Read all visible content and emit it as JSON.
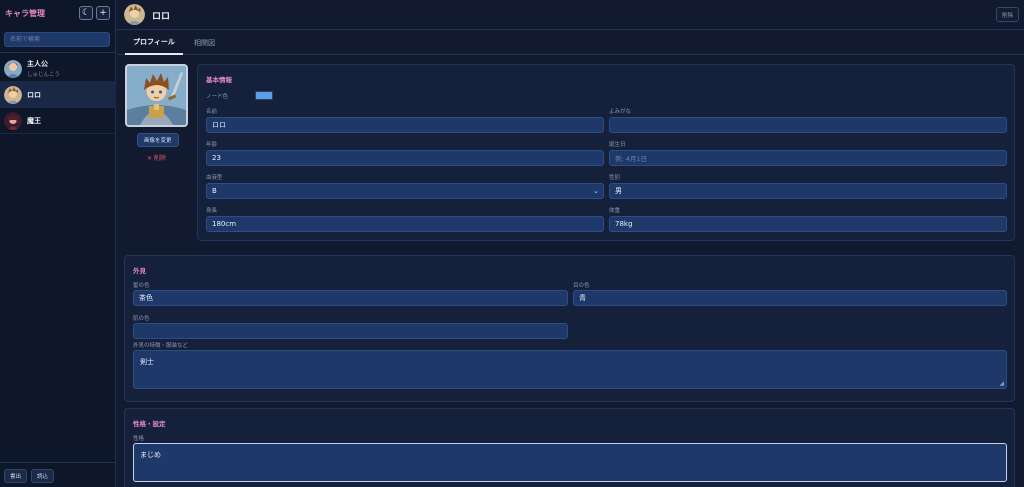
{
  "sidebar": {
    "title": "キャラ管理",
    "theme_icon": "☾",
    "add_icon": "+",
    "search_placeholder": "名前で検索",
    "characters": [
      {
        "name": "主人公",
        "reading": "しゅじんこう"
      },
      {
        "name": "ロロ",
        "reading": ""
      },
      {
        "name": "魔王",
        "reading": ""
      }
    ],
    "export_label": "書出",
    "import_label": "読込"
  },
  "header": {
    "name": "ロロ",
    "delete_label": "削除"
  },
  "tabs": [
    {
      "label": "プロフィール",
      "active": true
    },
    {
      "label": "相関図",
      "active": false
    }
  ],
  "image": {
    "change_label": "画像を変更",
    "delete_label": "✕ 削除"
  },
  "basic": {
    "title": "基本情報",
    "node_color_label": "ノード色",
    "node_color": "#5d9ee8",
    "name_label": "名前",
    "name_value": "ロロ",
    "reading_label": "よみがな",
    "reading_value": "",
    "age_label": "年齢",
    "age_value": "23",
    "birthday_label": "誕生日",
    "birthday_placeholder": "例: 4月1日",
    "blood_label": "血液型",
    "blood_value": "B",
    "gender_label": "性別",
    "gender_value": "男",
    "height_label": "身長",
    "height_value": "180cm",
    "weight_label": "体重",
    "weight_value": "78kg"
  },
  "appearance": {
    "title": "外見",
    "hair_label": "髪の色",
    "hair_value": "茶色",
    "eye_label": "目の色",
    "eye_value": "青",
    "skin_label": "肌の色",
    "skin_value": "",
    "features_label": "外見の特徴・服装など",
    "features_value": "剣士"
  },
  "personality": {
    "title": "性格・設定",
    "personality_label": "性格",
    "personality_value": "まじめ"
  },
  "colors": {
    "accent": "#e489c4",
    "field_bg": "#1d3869",
    "danger": "#e35a6c"
  }
}
